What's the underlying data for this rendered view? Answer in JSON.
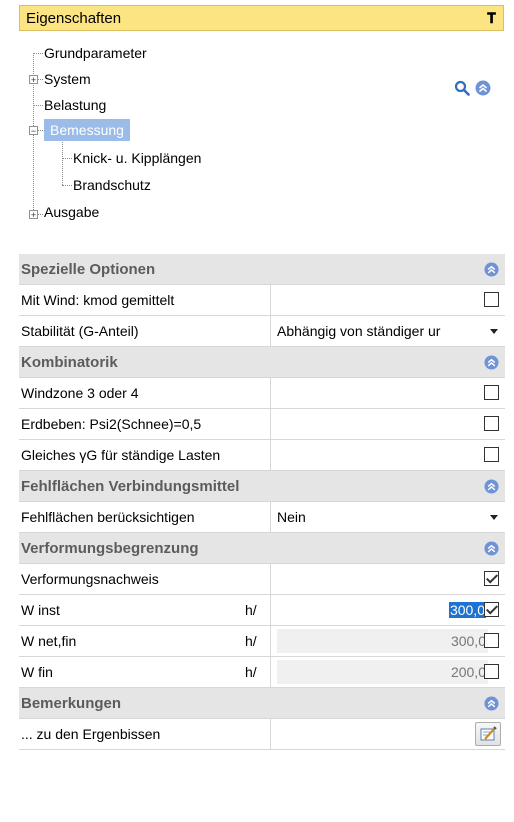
{
  "panel": {
    "title": "Eigenschaften"
  },
  "tree": {
    "items": [
      "Grundparameter",
      "System",
      "Belastung",
      "Bemessung",
      "Knick- u. Kipplängen",
      "Brandschutz",
      "Ausgabe"
    ],
    "selected": "Bemessung"
  },
  "sections": {
    "spezielle": {
      "title": "Spezielle Optionen",
      "wind_label": "Mit Wind: kmod gemittelt",
      "wind_checked": false,
      "stab_label": "Stabilität (G-Anteil)",
      "stab_value": "Abhängig von ständiger ur"
    },
    "kombinatorik": {
      "title": "Kombinatorik",
      "windzone_label": "Windzone 3 oder 4",
      "erdbeben_label": "Erdbeben: Psi2(Schnee)=0,5",
      "gleiches_label": "Gleiches γG für ständige Lasten"
    },
    "fehlflaechen": {
      "title": "Fehlflächen Verbindungsmittel",
      "label": "Fehlflächen berücksichtigen",
      "value": "Nein"
    },
    "verformung": {
      "title": "Verformungsbegrenzung",
      "nachweis_label": "Verformungsnachweis",
      "nachweis_checked": true,
      "winst_label": "W inst",
      "winst_unit": "h/",
      "winst_value": "300,0",
      "winst_checked": true,
      "wnet_label": "W net,fin",
      "wnet_unit": "h/",
      "wnet_value": "300,0",
      "wnet_checked": false,
      "wfin_label": "W fin",
      "wfin_unit": "h/",
      "wfin_value": "200,0",
      "wfin_checked": false
    },
    "bemerkungen": {
      "title": "Bemerkungen",
      "label": "... zu den Ergenbissen"
    }
  },
  "colors": {
    "title_bg": "#fce483",
    "selection": "#9bbbe8",
    "section_bg": "#e5e5e5",
    "accent_icon": "#6f93d6"
  }
}
